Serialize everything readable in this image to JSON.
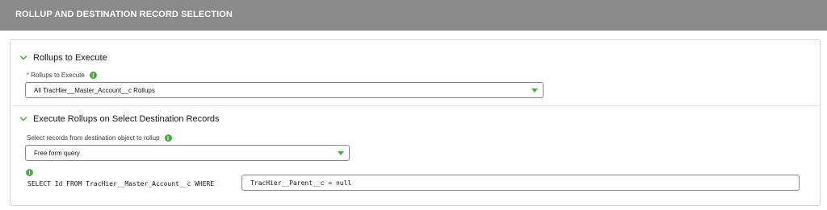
{
  "header": {
    "title": "ROLLUP AND DESTINATION RECORD SELECTION"
  },
  "sections": [
    {
      "title": "Rollups to Execute",
      "expanded": true,
      "field": {
        "required": true,
        "label": "Rollups to Execute",
        "selected_value": "All TracHier__Master_Account__c Rollups"
      }
    },
    {
      "title": "Execute Rollups on Select Destination Records",
      "expanded": true,
      "field": {
        "required": false,
        "label": "Select records from destination object to rollup",
        "selected_value": "Free form query"
      },
      "query": {
        "prefix": "SELECT Id FROM TracHier__Master_Account__c WHERE",
        "value": "TracHier__Parent__c = null"
      }
    }
  ],
  "colors": {
    "header_bg": "#8a8a8a",
    "accent_green": "#4bab3e",
    "required_red": "#c23934",
    "border": "#d4d4d4"
  },
  "icons": {
    "chevron": "chevron-down-icon",
    "info": "info-icon",
    "caret": "caret-down-icon"
  }
}
